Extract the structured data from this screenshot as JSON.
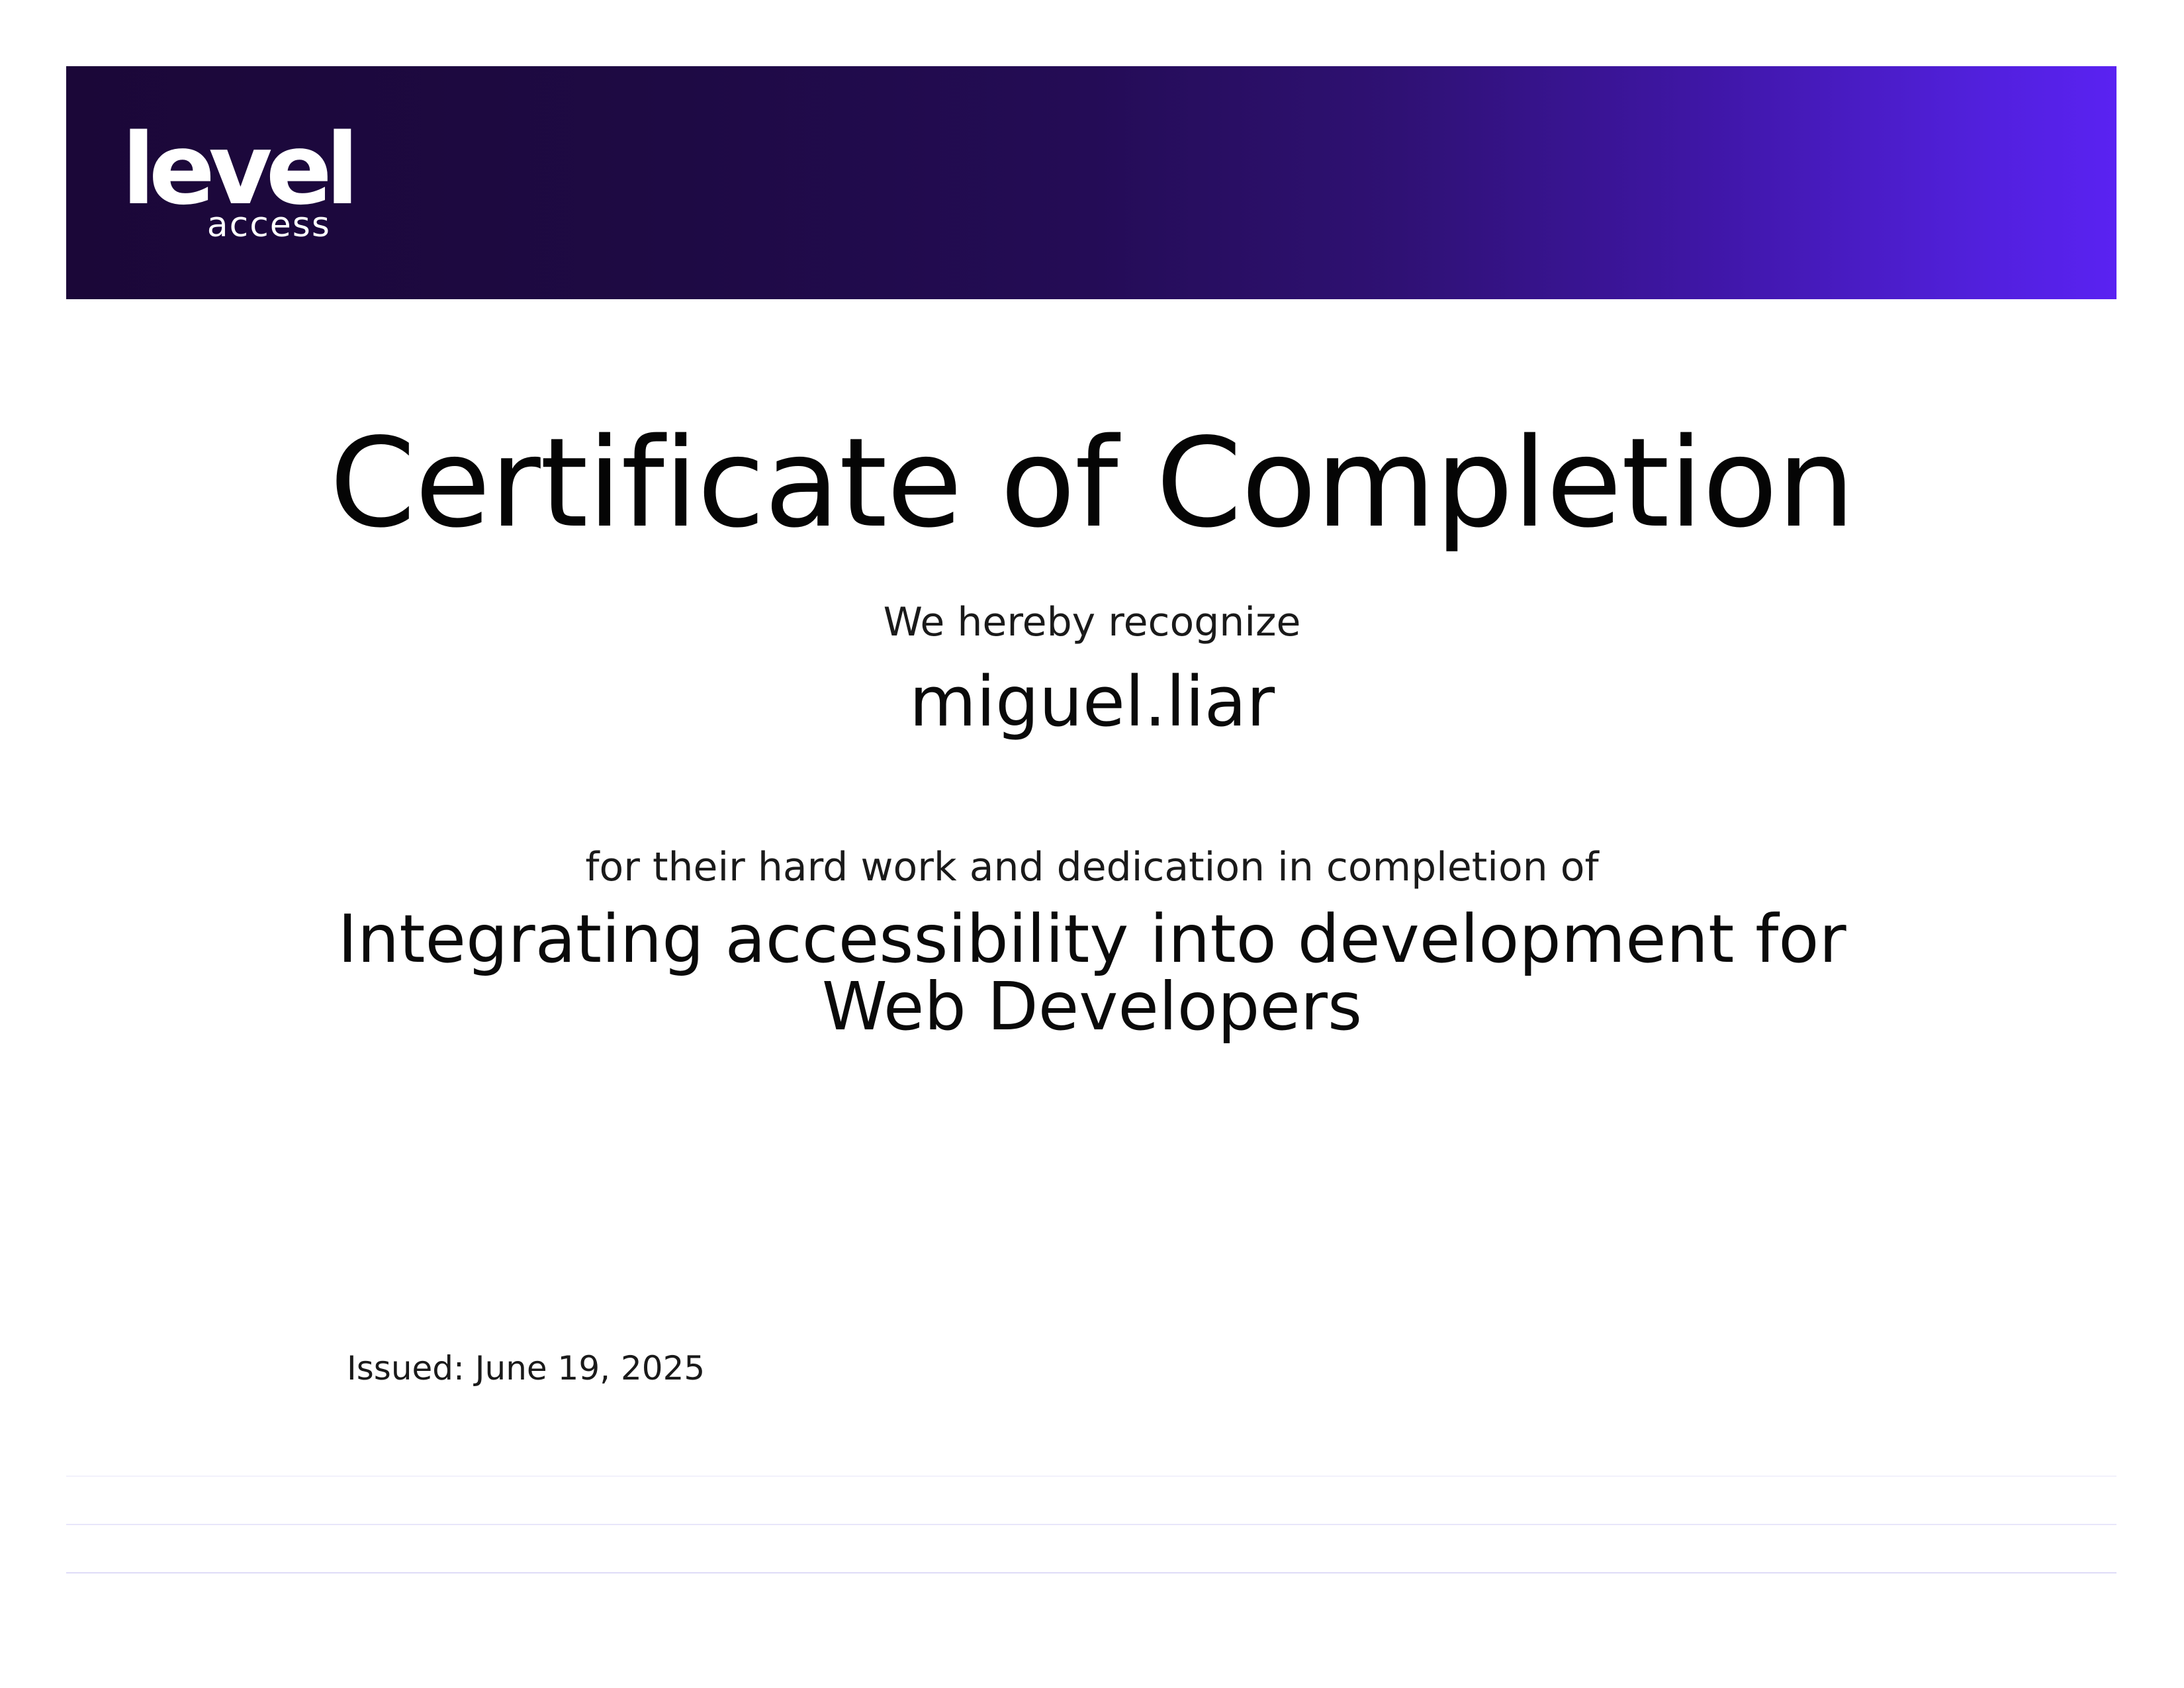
{
  "brand": {
    "wordmark": "level",
    "sub": "access"
  },
  "certificate": {
    "title": "Certificate of Completion",
    "recognize_text": "We hereby recognize",
    "recipient": "miguel.liar",
    "dedication_text": "for their hard work and dedication in completion of",
    "course_line1": "Integrating accessibility into development for",
    "course_line2": "Web Developers",
    "issued": "Issued: June 19, 2025"
  },
  "colors": {
    "banner_start": "#1b0738",
    "banner_end": "#5a22f2",
    "grid_line": "#d9d6f7"
  }
}
